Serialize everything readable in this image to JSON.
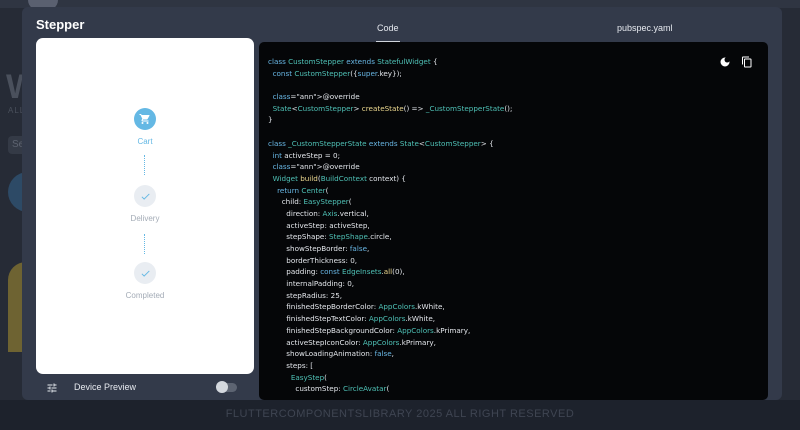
{
  "background": {
    "big_letter": "W",
    "small_text": "ALL",
    "search_text": "Se",
    "footer_text": "FLUTTERCOMPONENTSLIBRARY 2025 ALL RIGHT RESERVED"
  },
  "modal": {
    "title": "Stepper",
    "tabs": [
      {
        "label": "Code",
        "active": true
      },
      {
        "label": "pubspec.yaml",
        "active": false
      }
    ]
  },
  "preview": {
    "steps": [
      {
        "label": "Cart",
        "state": "active",
        "icon": "cart-icon"
      },
      {
        "label": "Delivery",
        "state": "done",
        "icon": "check-icon"
      },
      {
        "label": "Completed",
        "state": "done",
        "icon": "check-icon"
      }
    ],
    "device_preview_label": "Device Preview",
    "device_preview_enabled": false
  },
  "colors": {
    "accent": "#64b8e4",
    "modal_bg": "#333a4a",
    "code_bg": "#050608"
  },
  "code": {
    "lines": [
      "class CustomStepper extends StatefulWidget {",
      "  const CustomStepper({super.key});",
      "",
      "  @override",
      "  State<CustomStepper> createState() => _CustomStepperState();",
      "}",
      "",
      "class _CustomStepperState extends State<CustomStepper> {",
      "  int activeStep = 0;",
      "  @override",
      "  Widget build(BuildContext context) {",
      "    return Center(",
      "      child: EasyStepper(",
      "        direction: Axis.vertical,",
      "        activeStep: activeStep,",
      "        stepShape: StepShape.circle,",
      "        showStepBorder: false,",
      "        borderThickness: 0,",
      "        padding: const EdgeInsets.all(0),",
      "        internalPadding: 0,",
      "        stepRadius: 25,",
      "        finishedStepBorderColor: AppColors.kWhite,",
      "        finishedStepTextColor: AppColors.kWhite,",
      "        finishedStepBackgroundColor: AppColors.kPrimary,",
      "        activeStepIconColor: AppColors.kPrimary,",
      "        showLoadingAnimation: false,",
      "        steps: [",
      "          EasyStep(",
      "            customStep: CircleAvatar("
    ]
  }
}
